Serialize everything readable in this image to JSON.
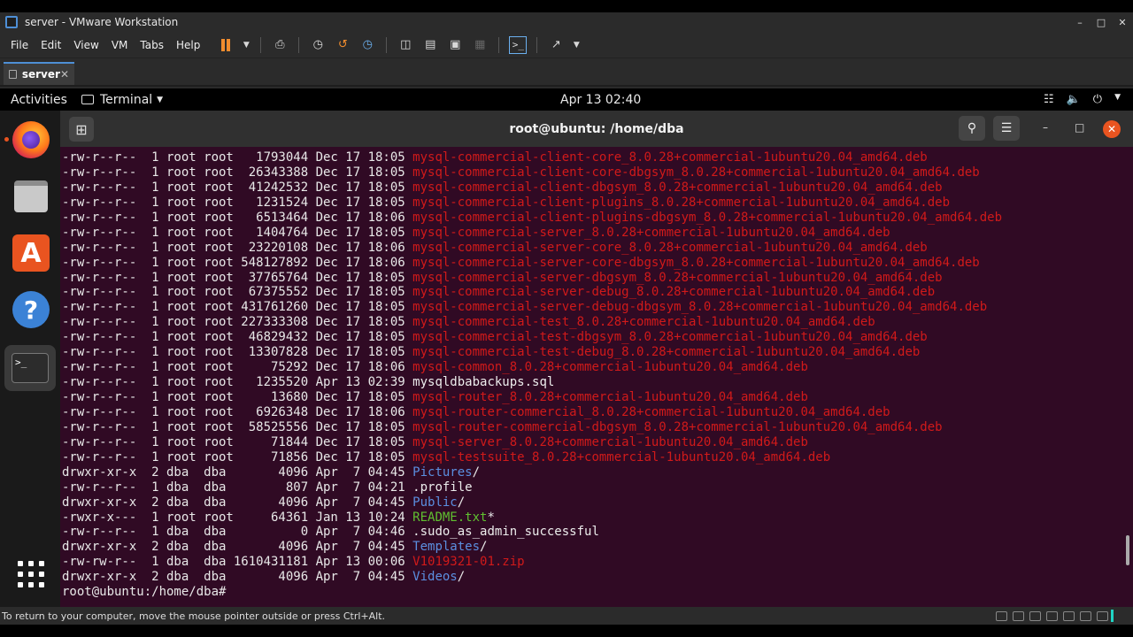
{
  "window": {
    "title": "server - VMware Workstation"
  },
  "menu": [
    "File",
    "Edit",
    "View",
    "VM",
    "Tabs",
    "Help"
  ],
  "vm_tab": {
    "label": "server"
  },
  "topbar": {
    "activities": "Activities",
    "app": "Terminal",
    "clock": "Apr 13  02:40"
  },
  "terminal": {
    "title": "root@ubuntu: /home/dba",
    "prompt": "root@ubuntu:/home/dba#",
    "lines": [
      {
        "meta": "-rw-r--r--  1 root root   1793044 Dec 17 18:05 ",
        "name": "mysql-commercial-client-core_8.0.28+commercial-1ubuntu20.04_amd64.deb",
        "color": "red"
      },
      {
        "meta": "-rw-r--r--  1 root root  26343388 Dec 17 18:05 ",
        "name": "mysql-commercial-client-core-dbgsym_8.0.28+commercial-1ubuntu20.04_amd64.deb",
        "color": "red"
      },
      {
        "meta": "-rw-r--r--  1 root root  41242532 Dec 17 18:05 ",
        "name": "mysql-commercial-client-dbgsym_8.0.28+commercial-1ubuntu20.04_amd64.deb",
        "color": "red"
      },
      {
        "meta": "-rw-r--r--  1 root root   1231524 Dec 17 18:05 ",
        "name": "mysql-commercial-client-plugins_8.0.28+commercial-1ubuntu20.04_amd64.deb",
        "color": "red"
      },
      {
        "meta": "-rw-r--r--  1 root root   6513464 Dec 17 18:06 ",
        "name": "mysql-commercial-client-plugins-dbgsym_8.0.28+commercial-1ubuntu20.04_amd64.deb",
        "color": "red"
      },
      {
        "meta": "-rw-r--r--  1 root root   1404764 Dec 17 18:05 ",
        "name": "mysql-commercial-server_8.0.28+commercial-1ubuntu20.04_amd64.deb",
        "color": "red"
      },
      {
        "meta": "-rw-r--r--  1 root root  23220108 Dec 17 18:06 ",
        "name": "mysql-commercial-server-core_8.0.28+commercial-1ubuntu20.04_amd64.deb",
        "color": "red"
      },
      {
        "meta": "-rw-r--r--  1 root root 548127892 Dec 17 18:06 ",
        "name": "mysql-commercial-server-core-dbgsym_8.0.28+commercial-1ubuntu20.04_amd64.deb",
        "color": "red"
      },
      {
        "meta": "-rw-r--r--  1 root root  37765764 Dec 17 18:05 ",
        "name": "mysql-commercial-server-dbgsym_8.0.28+commercial-1ubuntu20.04_amd64.deb",
        "color": "red"
      },
      {
        "meta": "-rw-r--r--  1 root root  67375552 Dec 17 18:05 ",
        "name": "mysql-commercial-server-debug_8.0.28+commercial-1ubuntu20.04_amd64.deb",
        "color": "red"
      },
      {
        "meta": "-rw-r--r--  1 root root 431761260 Dec 17 18:05 ",
        "name": "mysql-commercial-server-debug-dbgsym_8.0.28+commercial-1ubuntu20.04_amd64.deb",
        "color": "red"
      },
      {
        "meta": "-rw-r--r--  1 root root 227333308 Dec 17 18:05 ",
        "name": "mysql-commercial-test_8.0.28+commercial-1ubuntu20.04_amd64.deb",
        "color": "red"
      },
      {
        "meta": "-rw-r--r--  1 root root  46829432 Dec 17 18:05 ",
        "name": "mysql-commercial-test-dbgsym_8.0.28+commercial-1ubuntu20.04_amd64.deb",
        "color": "red"
      },
      {
        "meta": "-rw-r--r--  1 root root  13307828 Dec 17 18:05 ",
        "name": "mysql-commercial-test-debug_8.0.28+commercial-1ubuntu20.04_amd64.deb",
        "color": "red"
      },
      {
        "meta": "-rw-r--r--  1 root root     75292 Dec 17 18:06 ",
        "name": "mysql-common_8.0.28+commercial-1ubuntu20.04_amd64.deb",
        "color": "red"
      },
      {
        "meta": "-rw-r--r--  1 root root   1235520 Apr 13 02:39 ",
        "name": "mysqldbabackups.sql",
        "color": "plain"
      },
      {
        "meta": "-rw-r--r--  1 root root     13680 Dec 17 18:05 ",
        "name": "mysql-router_8.0.28+commercial-1ubuntu20.04_amd64.deb",
        "color": "red"
      },
      {
        "meta": "-rw-r--r--  1 root root   6926348 Dec 17 18:06 ",
        "name": "mysql-router-commercial_8.0.28+commercial-1ubuntu20.04_amd64.deb",
        "color": "red"
      },
      {
        "meta": "-rw-r--r--  1 root root  58525556 Dec 17 18:05 ",
        "name": "mysql-router-commercial-dbgsym_8.0.28+commercial-1ubuntu20.04_amd64.deb",
        "color": "red"
      },
      {
        "meta": "-rw-r--r--  1 root root     71844 Dec 17 18:05 ",
        "name": "mysql-server_8.0.28+commercial-1ubuntu20.04_amd64.deb",
        "color": "red"
      },
      {
        "meta": "-rw-r--r--  1 root root     71856 Dec 17 18:05 ",
        "name": "mysql-testsuite_8.0.28+commercial-1ubuntu20.04_amd64.deb",
        "color": "red"
      },
      {
        "meta": "drwxr-xr-x  2 dba  dba       4096 Apr  7 04:45 ",
        "name": "Pictures",
        "suffix": "/",
        "color": "blue"
      },
      {
        "meta": "-rw-r--r--  1 dba  dba        807 Apr  7 04:21 ",
        "name": ".profile",
        "color": "plain"
      },
      {
        "meta": "drwxr-xr-x  2 dba  dba       4096 Apr  7 04:45 ",
        "name": "Public",
        "suffix": "/",
        "color": "blue"
      },
      {
        "meta": "-rwxr-x---  1 root root     64361 Jan 13 10:24 ",
        "name": "README.txt",
        "suffix": "*",
        "color": "green"
      },
      {
        "meta": "-rw-r--r--  1 dba  dba          0 Apr  7 04:46 ",
        "name": ".sudo_as_admin_successful",
        "color": "plain"
      },
      {
        "meta": "drwxr-xr-x  2 dba  dba       4096 Apr  7 04:45 ",
        "name": "Templates",
        "suffix": "/",
        "color": "blue"
      },
      {
        "meta": "-rw-rw-r--  1 dba  dba 1610431181 Apr 13 00:06 ",
        "name": "V1019321-01.zip",
        "color": "red"
      },
      {
        "meta": "drwxr-xr-x  2 dba  dba       4096 Apr  7 04:45 ",
        "name": "Videos",
        "suffix": "/",
        "color": "blue"
      }
    ]
  },
  "statusbar": {
    "hint": "To return to your computer, move the mouse pointer outside or press Ctrl+Alt."
  },
  "colors": {
    "terminal_bg": "#300a24",
    "ls_red": "#d11a1a",
    "ls_blue": "#5b8fe0",
    "ls_green": "#60c030",
    "ubuntu_orange": "#e95420"
  },
  "icons": [
    "vmware-icon",
    "pause-icon",
    "send-ctrl-alt-del-icon",
    "snapshot-icon",
    "revert-snapshot-icon",
    "snapshot-manager-icon",
    "library-icon",
    "console-view-icon",
    "fullscreen-icon",
    "unity-icon",
    "terminal-view-icon",
    "stretch-icon",
    "firefox-icon",
    "files-icon",
    "software-icon",
    "help-icon",
    "terminal-icon",
    "show-apps-icon",
    "network-icon",
    "volume-icon",
    "power-icon",
    "search-icon",
    "hamburger-icon"
  ]
}
